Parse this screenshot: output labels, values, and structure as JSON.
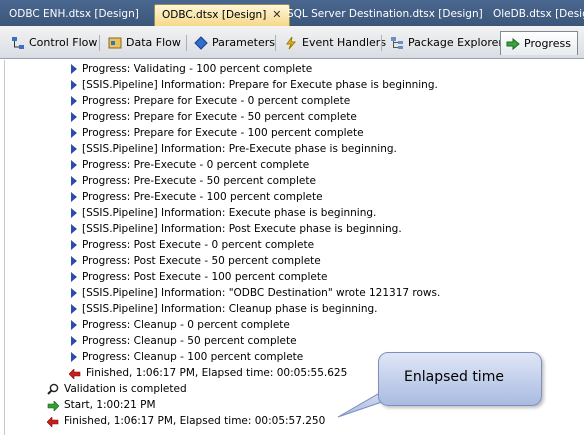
{
  "doc_tabs": [
    {
      "label": "ODBC ENH.dtsx [Design]"
    },
    {
      "label": "ODBC.dtsx [Design]",
      "close": "✕"
    },
    {
      "label": "SQL Server Destination.dtsx [Design]"
    },
    {
      "label": "OleDB.dtsx [Design]"
    }
  ],
  "designer_tabs": [
    {
      "label": "Control Flow",
      "icon": "control-flow-icon"
    },
    {
      "label": "Data Flow",
      "icon": "data-flow-icon"
    },
    {
      "label": "Parameters",
      "icon": "parameters-icon"
    },
    {
      "label": "Event Handlers",
      "icon": "event-handlers-icon"
    },
    {
      "label": "Package Explorer",
      "icon": "package-explorer-icon"
    },
    {
      "label": "Progress",
      "icon": "progress-icon"
    }
  ],
  "log": [
    {
      "text": "Progress: Validating - 100 percent complete"
    },
    {
      "text": "[SSIS.Pipeline] Information: Prepare for Execute phase is beginning."
    },
    {
      "text": "Progress: Prepare for Execute - 0 percent complete"
    },
    {
      "text": "Progress: Prepare for Execute - 50 percent complete"
    },
    {
      "text": "Progress: Prepare for Execute - 100 percent complete"
    },
    {
      "text": "[SSIS.Pipeline] Information: Pre-Execute phase is beginning."
    },
    {
      "text": "Progress: Pre-Execute - 0 percent complete"
    },
    {
      "text": "Progress: Pre-Execute - 50 percent complete"
    },
    {
      "text": "Progress: Pre-Execute - 100 percent complete"
    },
    {
      "text": "[SSIS.Pipeline] Information: Execute phase is beginning."
    },
    {
      "text": "[SSIS.Pipeline] Information: Post Execute phase is beginning."
    },
    {
      "text": "Progress: Post Execute - 0 percent complete"
    },
    {
      "text": "Progress: Post Execute - 50 percent complete"
    },
    {
      "text": "Progress: Post Execute - 100 percent complete"
    },
    {
      "text": "[SSIS.Pipeline] Information: \"ODBC Destination\" wrote 121317 rows."
    },
    {
      "text": "[SSIS.Pipeline] Information: Cleanup phase is beginning."
    },
    {
      "text": "Progress: Cleanup - 0 percent complete"
    },
    {
      "text": "Progress: Cleanup - 50 percent complete"
    },
    {
      "text": "Progress: Cleanup - 100 percent complete"
    }
  ],
  "task_finished": "Finished, 1:06:17 PM, Elapsed time: 00:05:55.625",
  "validation": "Validation is completed",
  "start": "Start, 1:00:21 PM",
  "package_finished": "Finished, 1:06:17 PM, Elapsed time: 00:05:57.250",
  "callout": "Enlapsed time"
}
